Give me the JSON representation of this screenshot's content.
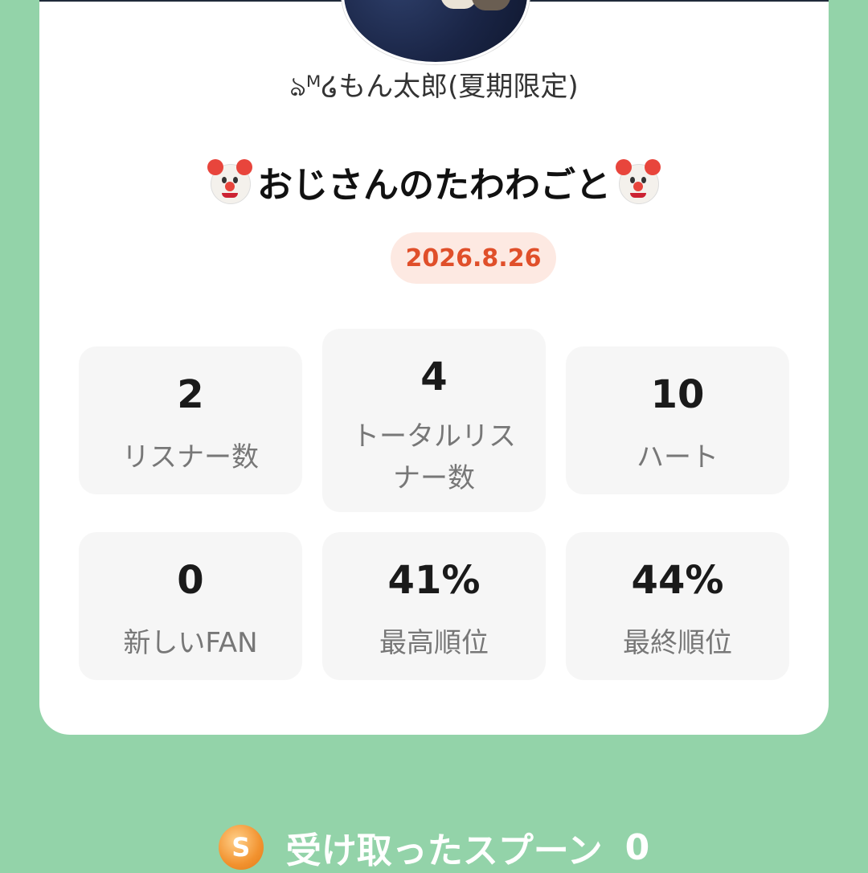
{
  "profile": {
    "username": "ঌᴹ໒もん太郎(夏期限定)"
  },
  "broadcast": {
    "title": "おじさんのたわわごと",
    "date": "2026.8.26"
  },
  "stats": [
    {
      "value": "2",
      "label": "リスナー数"
    },
    {
      "value": "4",
      "label_line1": "トータルリス",
      "label_line2": "ナー数"
    },
    {
      "value": "10",
      "label": "ハート"
    },
    {
      "value": "0",
      "label": "新しいFAN"
    },
    {
      "value": "41%",
      "label": "最高順位"
    },
    {
      "value": "44%",
      "label": "最終順位"
    }
  ],
  "footer": {
    "spoon_icon_letter": "S",
    "received_label": "受け取ったスプーン",
    "received_count": "0"
  },
  "colors": {
    "background": "#93d3a9",
    "date_badge_bg": "#fde9e2",
    "date_badge_text": "#e04f2a"
  }
}
